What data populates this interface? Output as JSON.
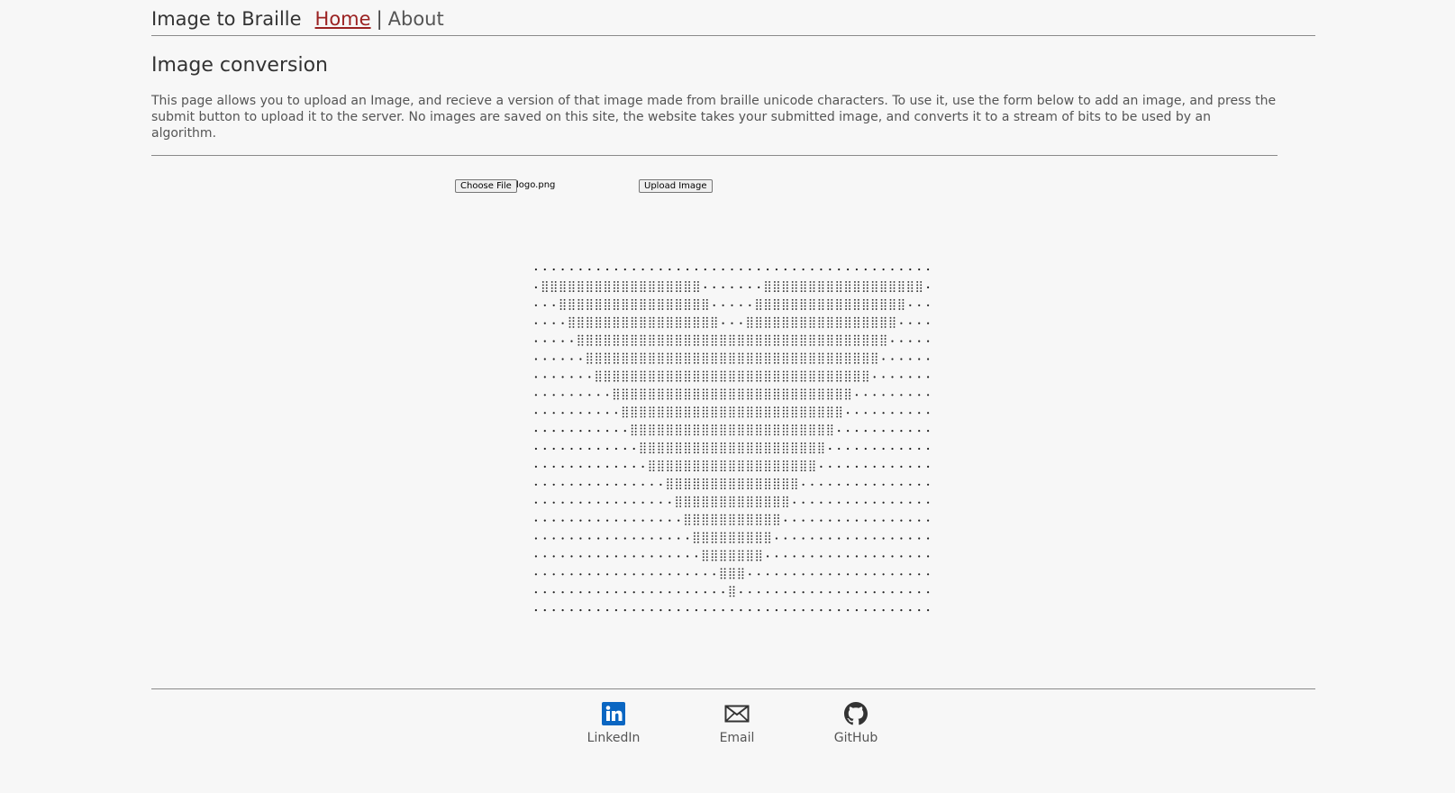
{
  "nav": {
    "brand": "Image to Braille",
    "home_label": "Home",
    "separator": "|",
    "about_label": "About"
  },
  "main": {
    "title": "Image conversion",
    "intro": "This page allows you to upload an Image, and recieve a version of that image made from braille unicode characters. To use it, use the form below to add an image, and press the submit button to upload it to the server. No images are saved on this site, the website takes your submitted image, and converts it to a stream of bits to be used by an algorithm."
  },
  "form": {
    "choose_label": "Choose File",
    "file_name": "logo.png",
    "upload_label": "Upload Image"
  },
  "footer": {
    "links": [
      {
        "label": "LinkedIn",
        "icon": "linkedin-icon"
      },
      {
        "label": "Email",
        "icon": "envelope-icon"
      },
      {
        "label": "GitHub",
        "icon": "github-icon"
      }
    ]
  },
  "colors": {
    "background": "#f7f7f7",
    "active_link": "#9b2222",
    "linkedin": "#0a66c2",
    "divider": "#8a8a8a"
  }
}
